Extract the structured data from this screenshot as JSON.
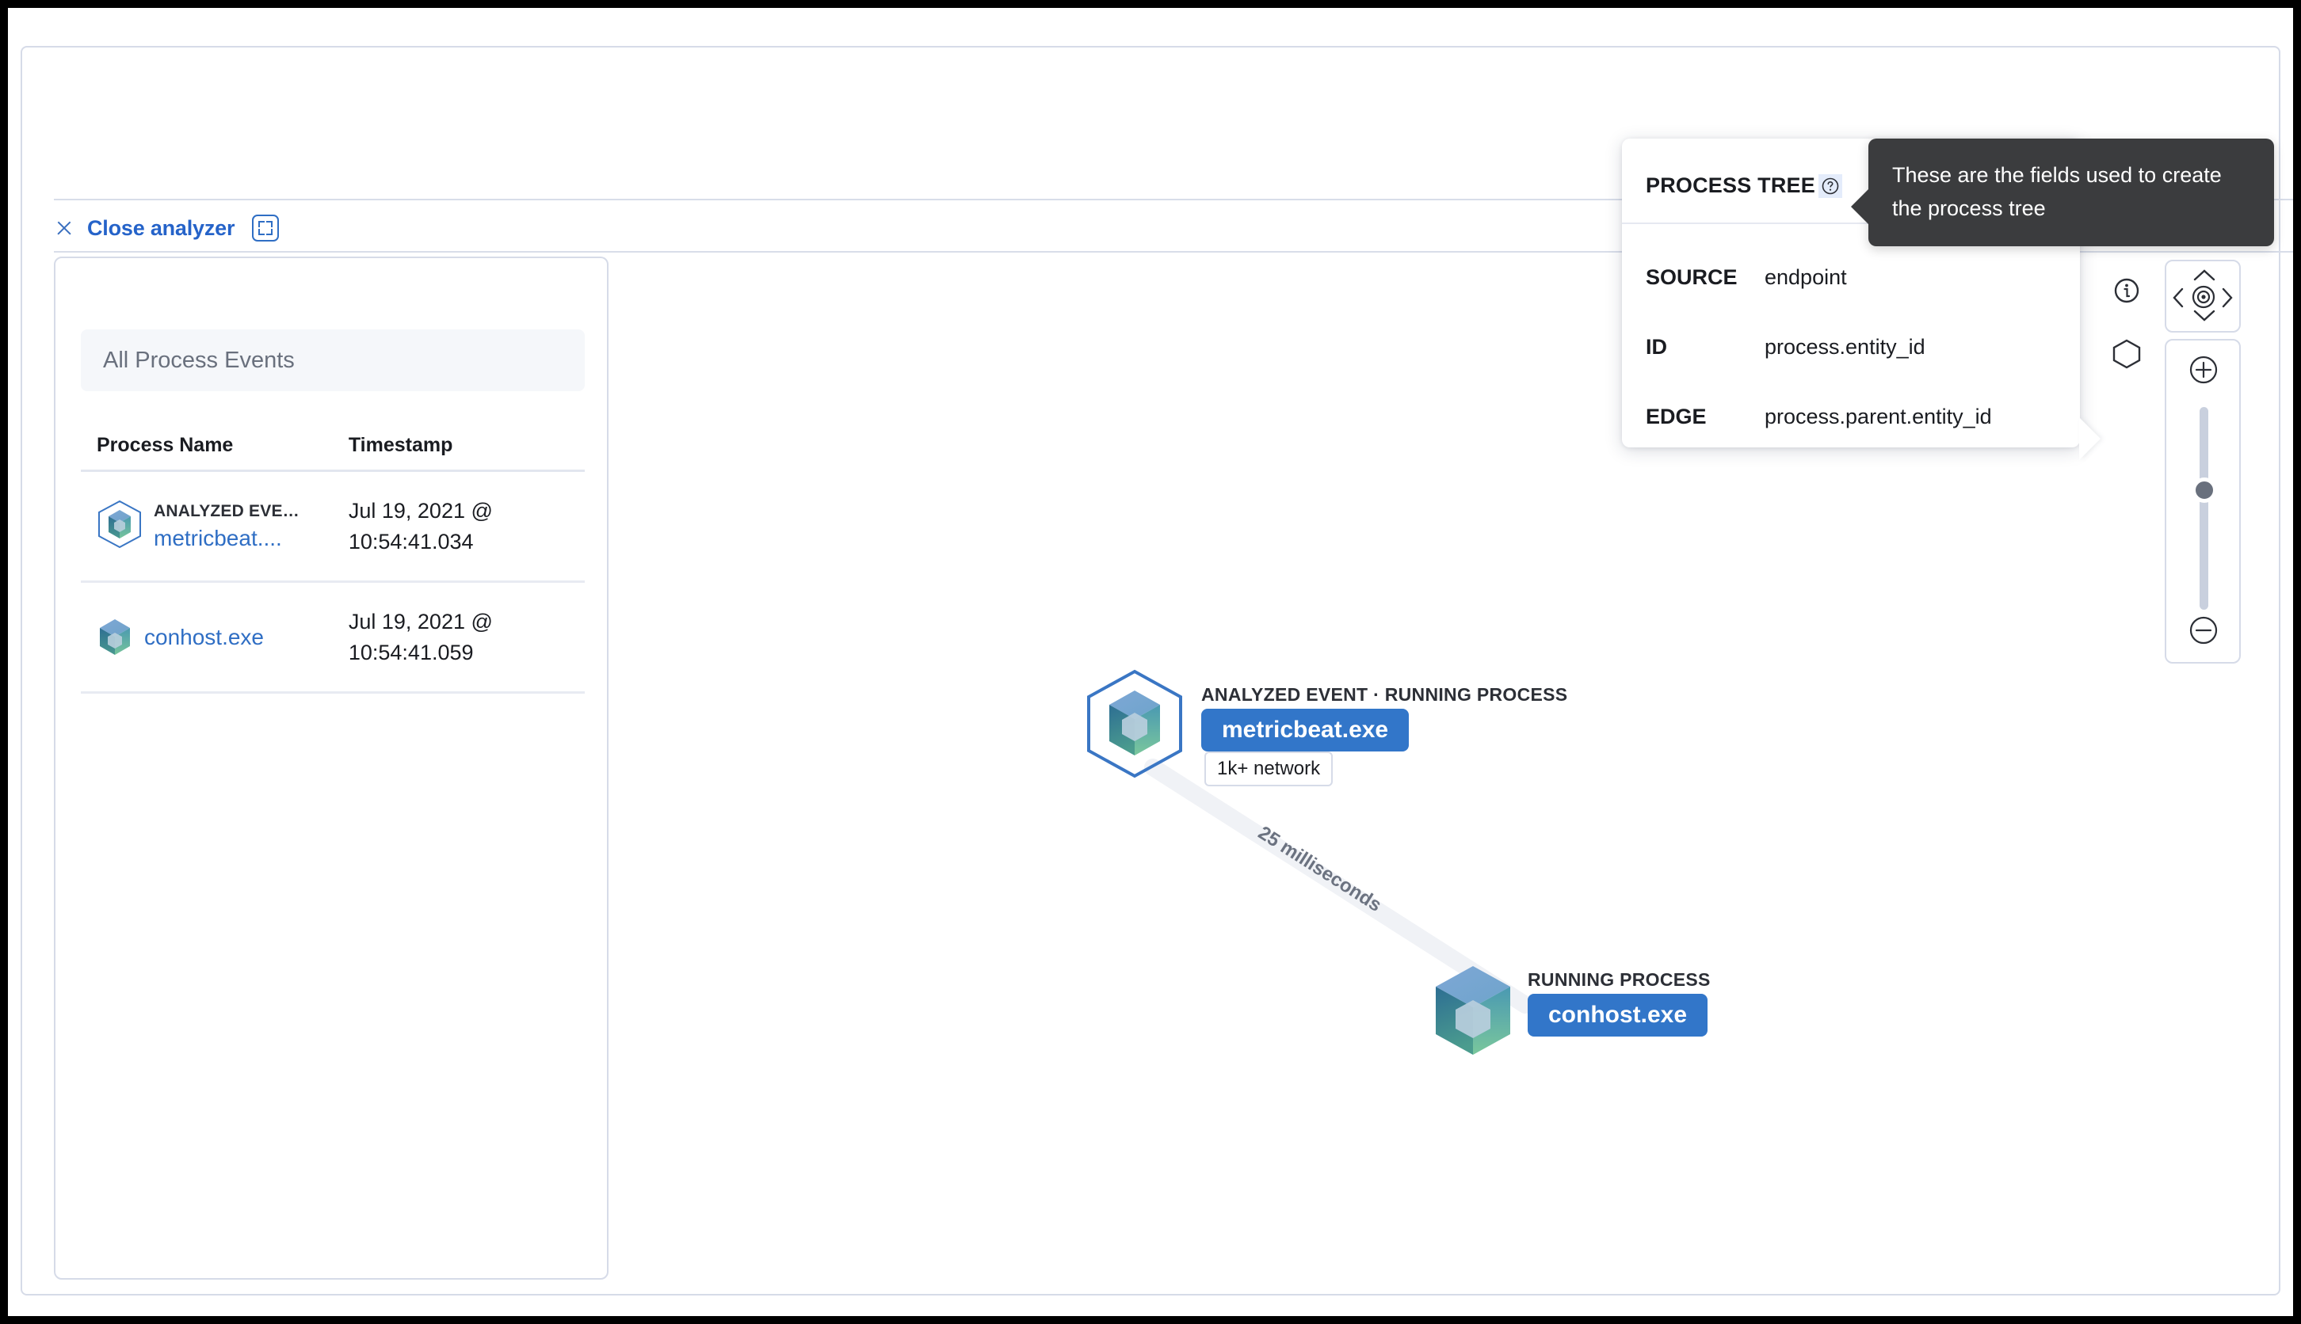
{
  "header": {
    "close_label": "Close analyzer",
    "close_icon": "close-icon",
    "fullscreen_icon": "fullscreen-icon"
  },
  "left_panel": {
    "search_placeholder": "All Process Events",
    "columns": [
      "Process Name",
      "Timestamp"
    ],
    "rows": [
      {
        "kicker": "ANALYZED EVE…",
        "name": "metricbeat....",
        "timestamp_line1": "Jul 19, 2021 @",
        "timestamp_line2": "10:54:41.034",
        "icon": "analyzed-process-cube-icon"
      },
      {
        "kicker": "",
        "name": "conhost.exe",
        "timestamp_line1": "Jul 19, 2021 @",
        "timestamp_line2": "10:54:41.059",
        "icon": "process-cube-icon"
      }
    ]
  },
  "graph": {
    "nodes": [
      {
        "kicker": "ANALYZED EVENT · RUNNING PROCESS",
        "label": "metricbeat.exe",
        "badge": "1k+ network",
        "icon": "analyzed-process-cube-icon"
      },
      {
        "kicker": "RUNNING PROCESS",
        "label": "conhost.exe",
        "icon": "process-cube-icon"
      }
    ],
    "edge_label": "25 milliseconds"
  },
  "popover": {
    "title": "PROCESS TREE",
    "help_icon": "question-mark-circle-icon",
    "fields": [
      {
        "key": "SOURCE",
        "value": "endpoint"
      },
      {
        "key": "ID",
        "value": "process.entity_id"
      },
      {
        "key": "EDGE",
        "value": "process.parent.entity_id"
      }
    ]
  },
  "tooltip": {
    "text": "These are the fields used to create the process tree"
  },
  "controls": {
    "info_icon": "info-circle-icon",
    "legend_icon": "hexagon-icon",
    "pan_up_icon": "chevron-up-icon",
    "pan_down_icon": "chevron-down-icon",
    "pan_left_icon": "chevron-left-icon",
    "pan_right_icon": "chevron-right-icon",
    "center_icon": "crosshair-icon",
    "zoom_in_icon": "plus-circle-icon",
    "zoom_out_icon": "minus-circle-icon",
    "zoom_value": 50
  },
  "colors": {
    "accent": "#2f6ec4",
    "pill": "#3276c9",
    "border": "#d6dbe8",
    "tooltip_bg": "#3b3c3e",
    "muted_text": "#69707d"
  }
}
